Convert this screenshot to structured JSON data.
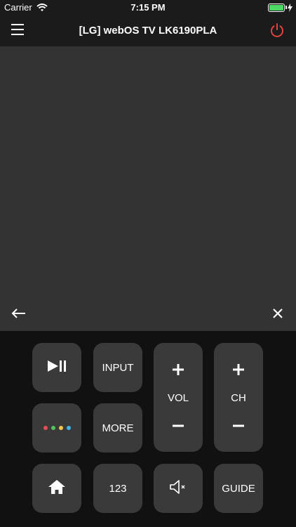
{
  "status_bar": {
    "carrier": "Carrier",
    "time": "7:15 PM",
    "battery_color": "#4cd964"
  },
  "nav": {
    "title": "[LG] webOS TV LK6190PLA",
    "menu_icon": "hamburger-menu-icon",
    "power_icon": "power-icon",
    "power_color": "#e0463f"
  },
  "touchpad": {
    "back_icon": "arrow-left-icon",
    "close_icon": "close-icon"
  },
  "remote": {
    "play_pause_icon": "play-pause-icon",
    "input_label": "INPUT",
    "vol": {
      "label": "VOL",
      "plus_icon": "plus-icon",
      "minus_icon": "minus-icon"
    },
    "ch": {
      "label": "CH",
      "plus_icon": "plus-icon",
      "minus_icon": "minus-icon"
    },
    "color_keys_icon": "color-dots-icon",
    "color_dots": [
      "#e84c5a",
      "#56c35a",
      "#f2c94c",
      "#3fb6e6"
    ],
    "more_label": "MORE",
    "home_icon": "home-icon",
    "number_label": "123",
    "mute_icon": "mute-icon",
    "guide_label": "GUIDE"
  }
}
